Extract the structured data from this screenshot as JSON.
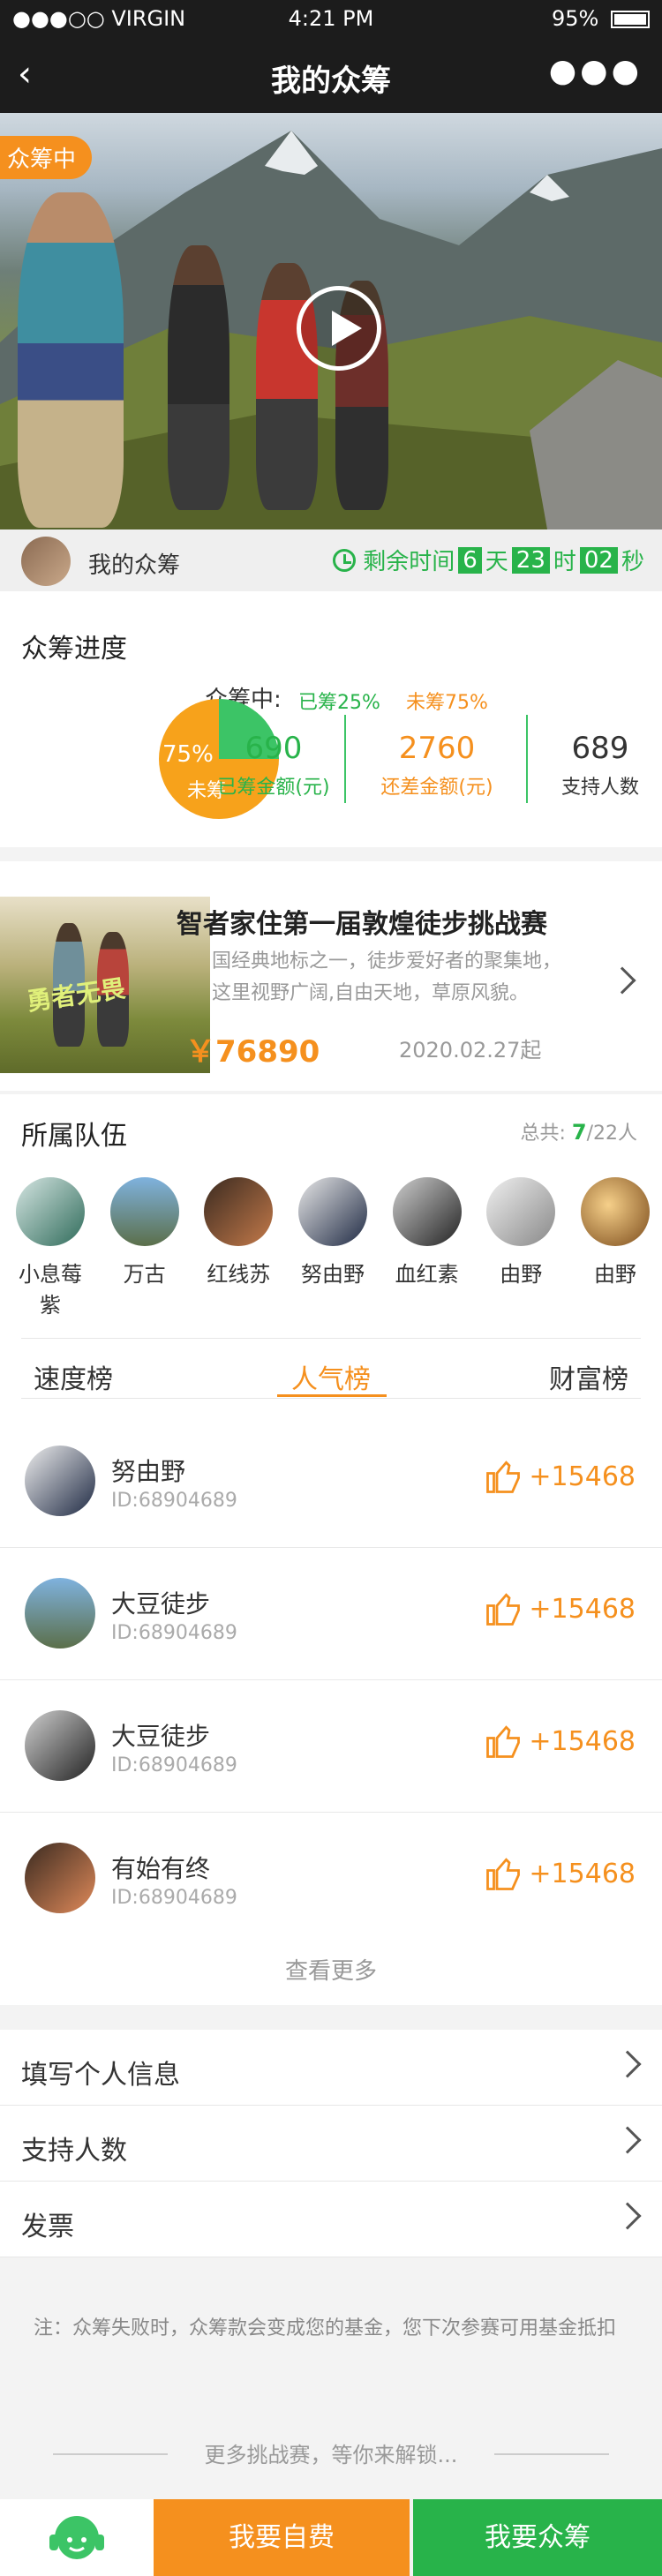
{
  "status_bar": {
    "carrier": "●●●○○ VIRGIN",
    "time": "4:21 PM",
    "battery": "95%"
  },
  "nav": {
    "title": "我的众筹",
    "back_icon": "chevron-left-icon",
    "more_icon": "more-dots-icon"
  },
  "hero": {
    "badge": "众筹中"
  },
  "time_row": {
    "label": "我的众筹",
    "prefix": "剩余时间",
    "days": "6",
    "days_unit": "天",
    "hours": "23",
    "hours_unit": "时",
    "minutes": "02",
    "minutes_unit": "秒"
  },
  "progress": {
    "title": "众筹进度",
    "status": "众筹中:",
    "raised_pct_label": "已筹25%",
    "remaining_pct_label": "未筹75%",
    "pie_pct": "75%",
    "pie_label": "未筹",
    "raised_fraction": 0.25,
    "stats": [
      {
        "value": "690",
        "key": "已筹金额(元)"
      },
      {
        "value": "2760",
        "key": "还差金额(元)"
      },
      {
        "value": "689",
        "key": "支持人数"
      }
    ]
  },
  "event": {
    "title": "智者家住第一届敦煌徒步挑战赛",
    "desc": "国经典地标之一，徒步爱好者的聚集地，这里视野广阔,自由天地，草原风貌。",
    "price": "￥76890",
    "date": "2020.02.27起",
    "img_text": "勇者无畏"
  },
  "team": {
    "title": "所属队伍",
    "total_label": "总共:",
    "total_current": "7",
    "total_max": "/22人",
    "members": [
      "小息莓紫",
      "万古",
      "红线苏",
      "努由野",
      "血红素",
      "由野",
      "由野"
    ]
  },
  "tabs": [
    "速度榜",
    "人气榜",
    "财富榜"
  ],
  "ranking": [
    {
      "name": "努由野",
      "id": "ID:68904689",
      "likes": "+15468"
    },
    {
      "name": "大豆徒步",
      "id": "ID:68904689",
      "likes": "+15468"
    },
    {
      "name": "大豆徒步",
      "id": "ID:68904689",
      "likes": "+15468"
    },
    {
      "name": "有始有终",
      "id": "ID:68904689",
      "likes": "+15468"
    }
  ],
  "see_more": "查看更多",
  "menu": [
    "填写个人信息",
    "支持人数",
    "发票"
  ],
  "note": "注：众筹失败时，众筹款会变成您的基金，您下次参赛可用基金抵扣",
  "unlock": "更多挑战赛，等你来解锁...",
  "bottom": {
    "self_pay": "我要自费",
    "crowdfund": "我要众筹",
    "service_icon": "customer-service-icon"
  },
  "colors": {
    "green": "#28b34a",
    "orange": "#f5901e",
    "dark": "#1c1c1c"
  }
}
